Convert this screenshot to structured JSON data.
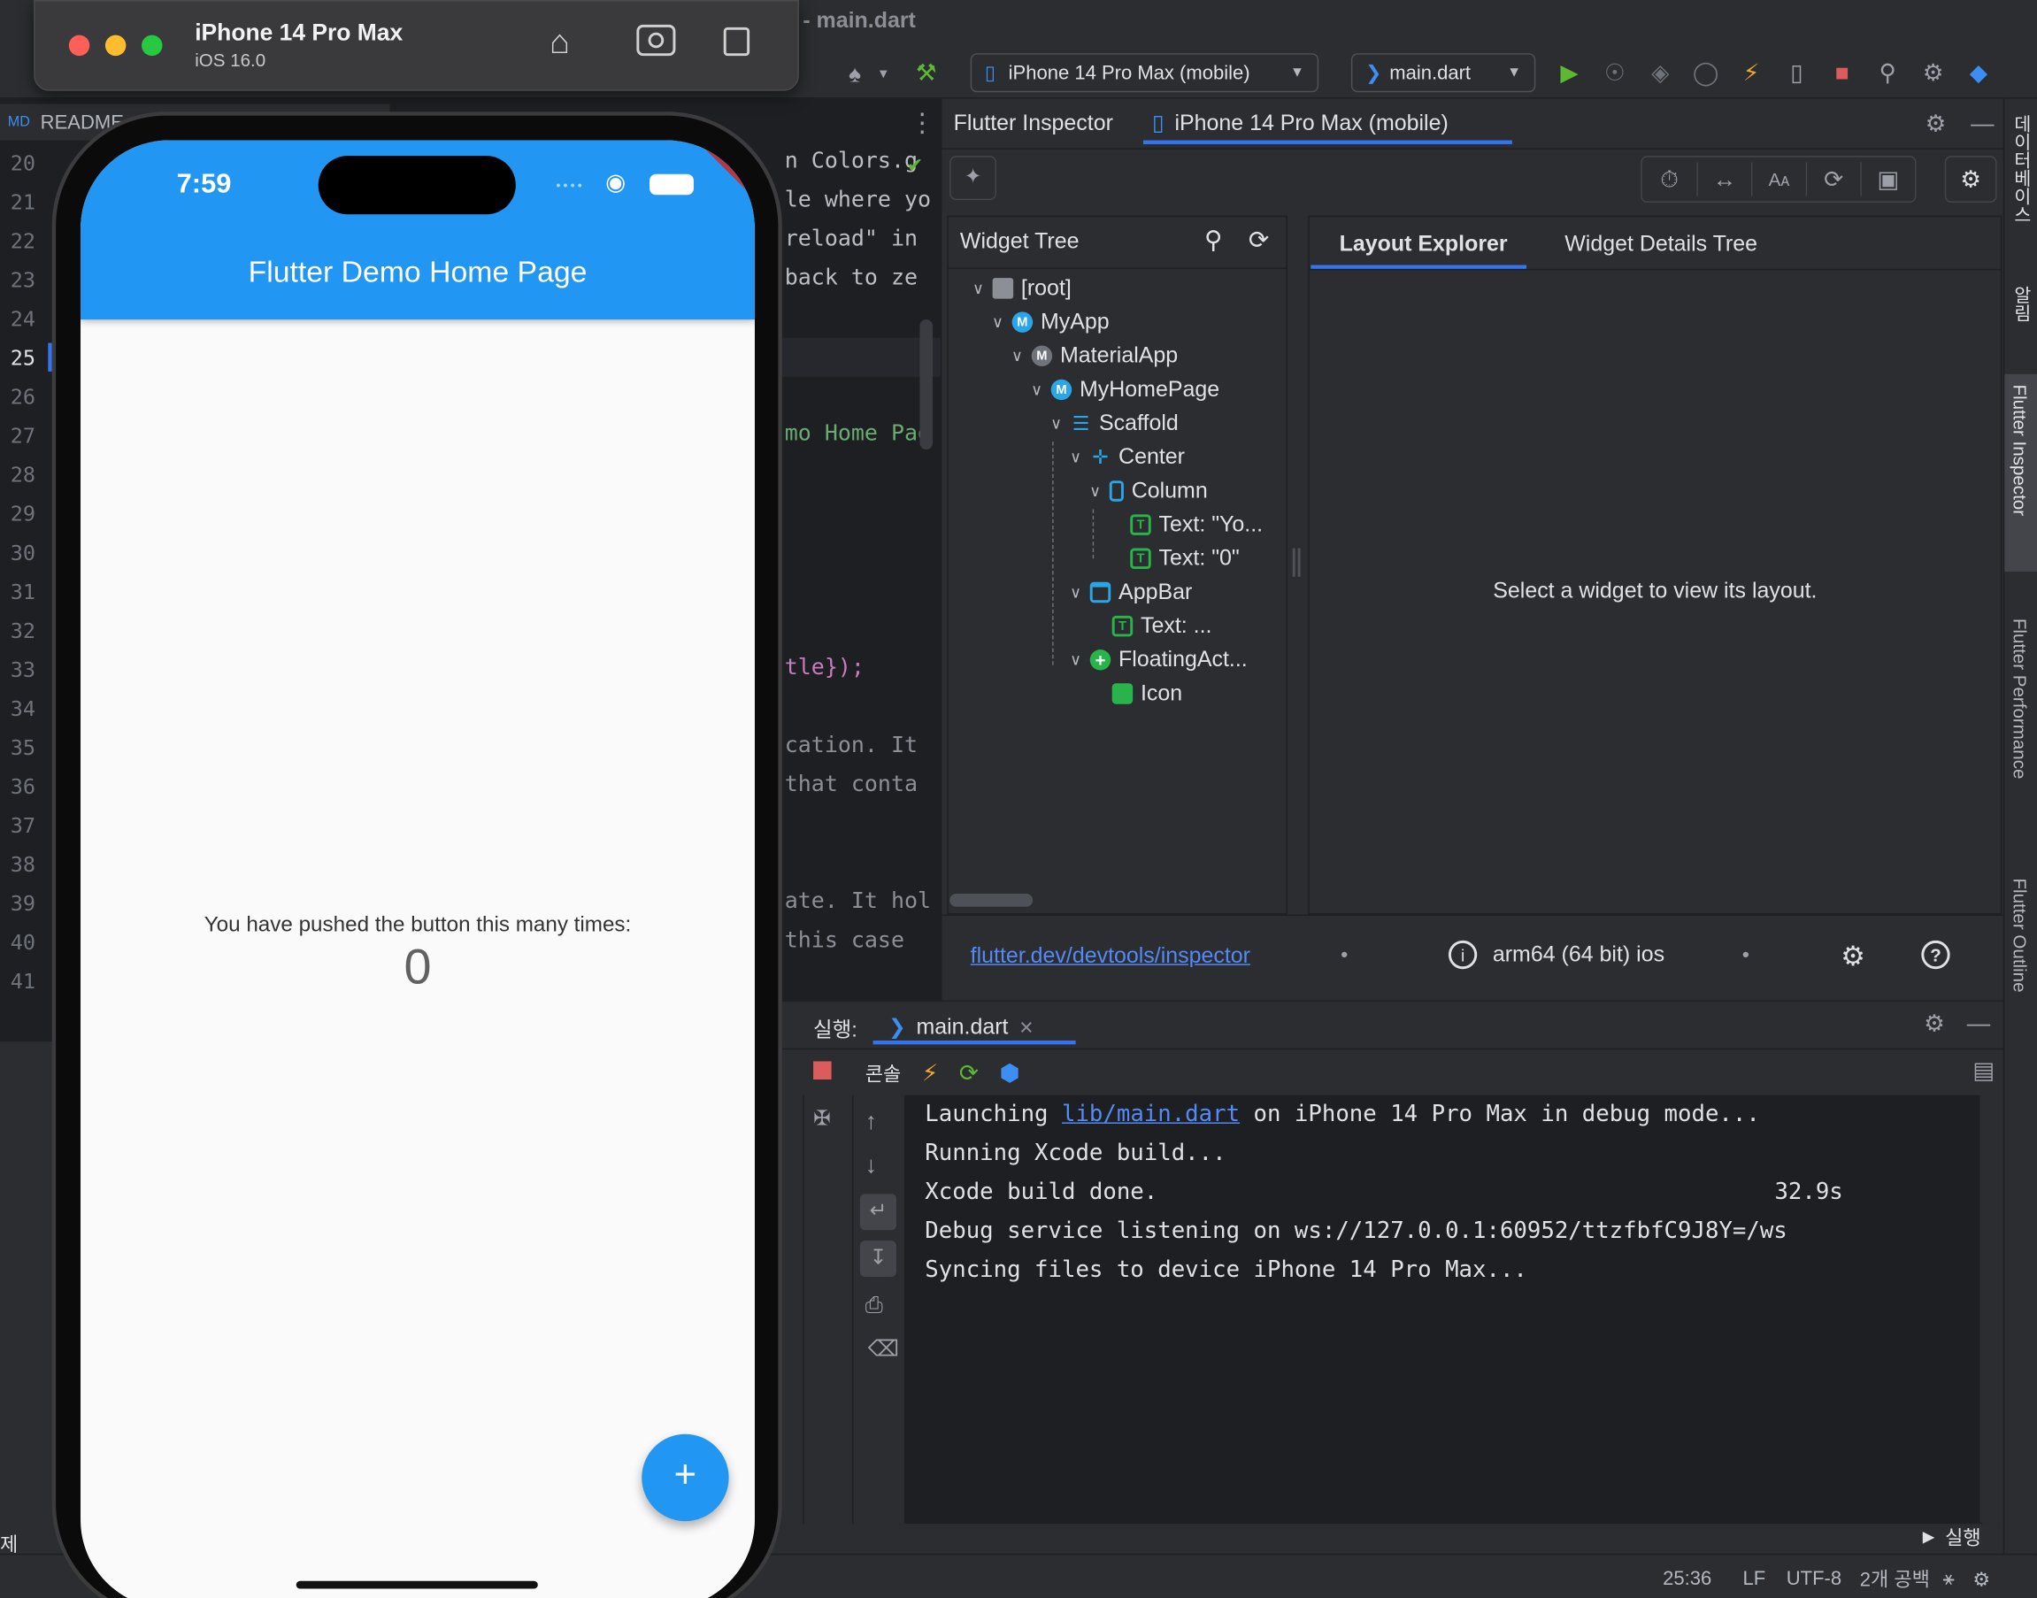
{
  "ide": {
    "file_title": "- main.dart",
    "device_combo": "iPhone 14 Pro Max (mobile)",
    "config_combo": "main.dart",
    "project_tab": "README"
  },
  "editor": {
    "line_numbers": [
      "20",
      "21",
      "22",
      "23",
      "24",
      "25",
      "26",
      "27",
      "28",
      "29",
      "30",
      "31",
      "32",
      "33",
      "34",
      "35",
      "36",
      "37",
      "38",
      "39",
      "40",
      "41"
    ],
    "code_fragments": {
      "l20": "n Colors.g",
      "l21": "le where yo",
      "l22": "reload\" in",
      "l23": " back to ze",
      "l27": "mo Home Pag",
      "l33": "tle});",
      "l35": "cation. It",
      "l36": " that conta",
      "l39": "ate. It hol",
      "l40": " this case"
    }
  },
  "simulator": {
    "device_name": "iPhone 14 Pro Max",
    "os_version": "iOS 16.0",
    "app": {
      "time": "7:59",
      "debug_banner": "DEBUG",
      "appbar_title": "Flutter Demo Home Page",
      "message": "You have pushed the button this many times:",
      "counter": "0",
      "fab_label": "+"
    }
  },
  "inspector": {
    "tabs": [
      "Flutter Inspector",
      "iPhone 14 Pro Max (mobile)"
    ],
    "widget_tree_title": "Widget Tree",
    "tree": [
      "[root]",
      "MyApp",
      "MaterialApp",
      "MyHomePage",
      "Scaffold",
      "Center",
      "Column",
      "Text: \"Yo...",
      "Text: \"0\"",
      "AppBar",
      "Text: ...",
      "FloatingAct...",
      "Icon"
    ],
    "right_tabs": [
      "Layout Explorer",
      "Widget Details Tree"
    ],
    "empty_message": "Select a widget to view its layout.",
    "footer_link": "flutter.dev/devtools/inspector",
    "footer_arch": "arm64 (64 bit) ios"
  },
  "run": {
    "label": "실행:",
    "tab": "main.dart",
    "console_label": "콘솔",
    "lines": [
      {
        "pre": "Launching ",
        "link": "lib/main.dart",
        "post": " on iPhone 14 Pro Max in debug mode..."
      },
      {
        "pre": "Running Xcode build...",
        "link": "",
        "post": ""
      },
      {
        "pre": "Xcode build done.",
        "link": "",
        "post": ""
      },
      {
        "pre": "Debug service listening on ws://127.0.0.1:60952/ttzfbfC9J8Y=/ws",
        "link": "",
        "post": ""
      },
      {
        "pre": "Syncing files to device iPhone 14 Pro Max...",
        "link": "",
        "post": ""
      }
    ],
    "build_time": "32.9s",
    "run_button": "실행"
  },
  "right_strip": {
    "items": [
      "데이터베이스",
      "알림",
      "Flutter Inspector",
      "Flutter Performance",
      "Flutter Outline"
    ]
  },
  "status_bar": {
    "position": "25:36",
    "line_sep": "LF",
    "encoding": "UTF-8",
    "indent": "2개 공백",
    "left_cut": "제"
  },
  "colors": {
    "flutter_blue": "#2196f3",
    "ide_bg": "#2b2d30",
    "editor_bg": "#1e1f22",
    "accent": "#3574f0"
  }
}
